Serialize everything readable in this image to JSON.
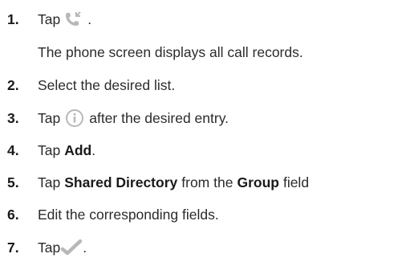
{
  "steps": [
    {
      "num": "1.",
      "pre": "Tap",
      "post": "."
    },
    {
      "note": "The phone screen displays all call records."
    },
    {
      "num": "2.",
      "text": "Select the desired list."
    },
    {
      "num": "3.",
      "pre": "Tap",
      "post": "after the desired entry."
    },
    {
      "num": "4.",
      "pre": "Tap",
      "bold": "Add",
      "post": "."
    },
    {
      "num": "5.",
      "pre": "Tap",
      "bold1": "Shared Directory",
      "mid": "from the",
      "bold2": "Group",
      "post": "field"
    },
    {
      "num": "6.",
      "text": "Edit the corresponding fields."
    },
    {
      "num": "7.",
      "pre": "Tap",
      "post": "."
    }
  ],
  "icons": {
    "step1": "call-log-icon",
    "step3": "info-icon",
    "step7": "checkmark-icon"
  },
  "colors": {
    "text": "#2b2b2b",
    "icon": "#b8b8b8"
  }
}
